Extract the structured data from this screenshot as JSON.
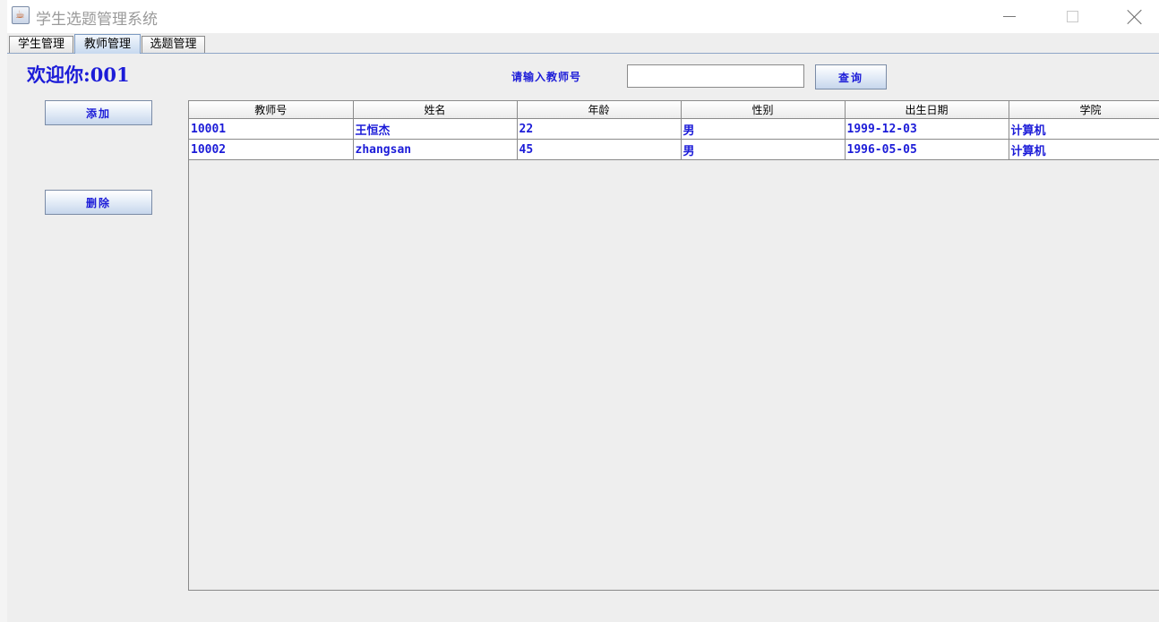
{
  "window": {
    "title": "学生选题管理系统",
    "icon": "java-cup-icon"
  },
  "tabs": [
    {
      "label": "学生管理",
      "active": false
    },
    {
      "label": "教师管理",
      "active": true
    },
    {
      "label": "选题管理",
      "active": false
    }
  ],
  "welcome": "欢迎你:001",
  "search": {
    "label": "请输入教师号",
    "value": "",
    "placeholder": "",
    "button_label": "查询"
  },
  "actions": {
    "add_label": "添加",
    "delete_label": "删除"
  },
  "table": {
    "columns": [
      "教师号",
      "姓名",
      "年龄",
      "性别",
      "出生日期",
      "学院"
    ],
    "rows": [
      [
        "10001",
        "王恒杰",
        "22",
        "男",
        "1999-12-03",
        "计算机"
      ],
      [
        "10002",
        "zhangsan",
        "45",
        "男",
        "1996-05-05",
        "计算机"
      ]
    ]
  },
  "colors": {
    "accent_text": "#1c1cd8",
    "tab_active": "#c7d9ef",
    "panel_bg": "#eeeeee"
  }
}
